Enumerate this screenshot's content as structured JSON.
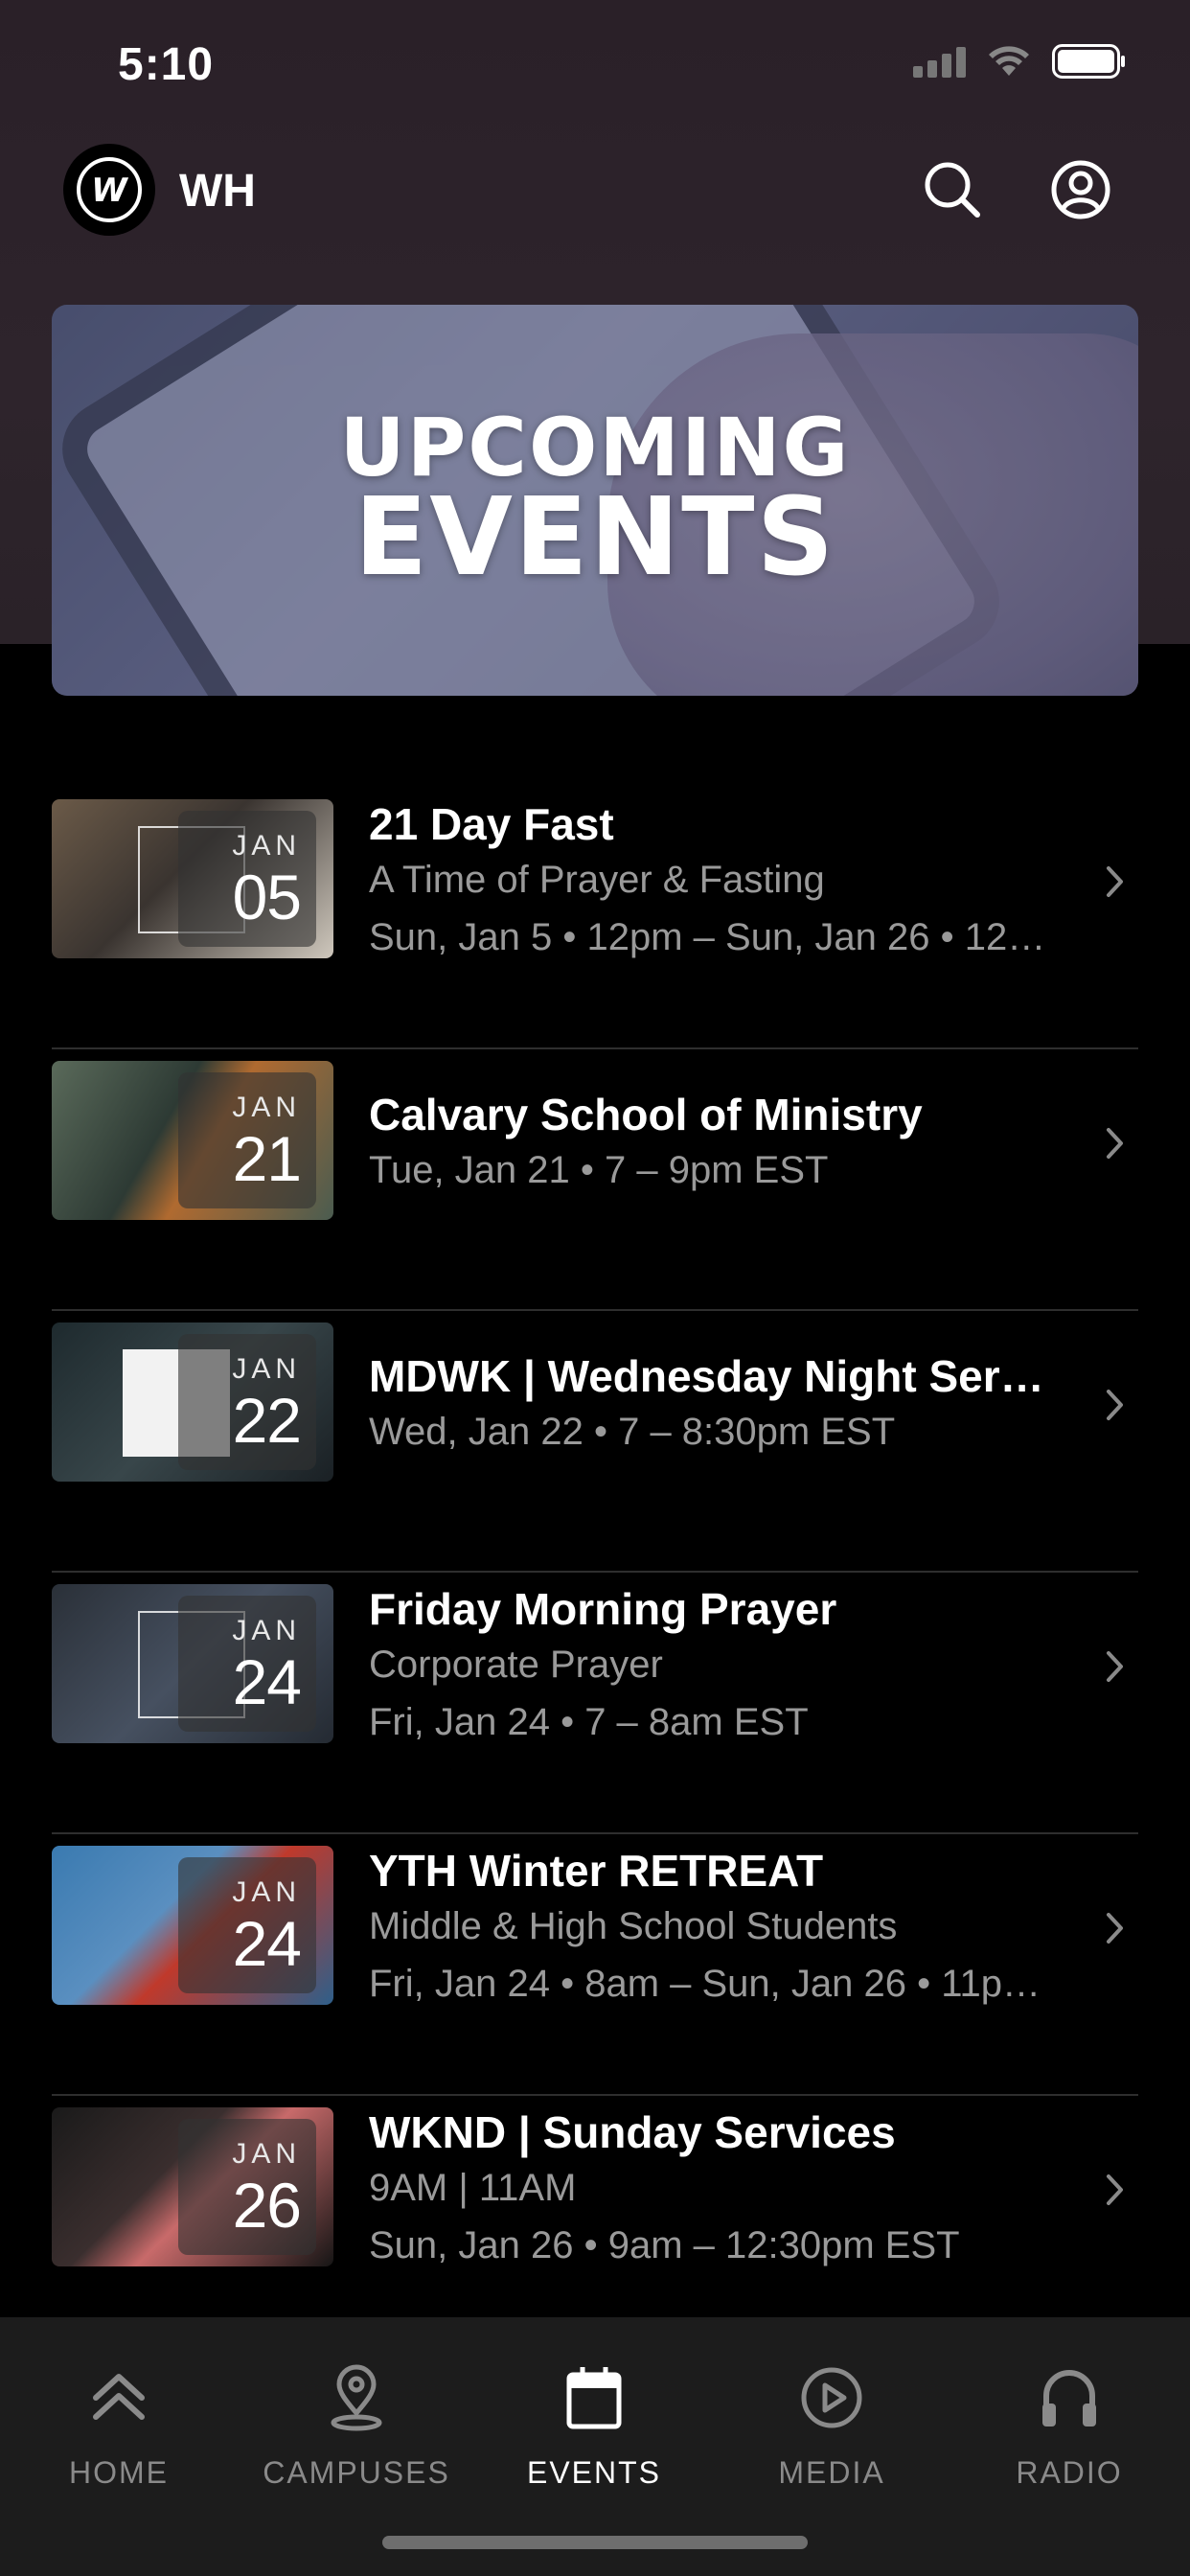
{
  "status_bar": {
    "time": "5:10"
  },
  "header": {
    "org_name": "WH",
    "logo_text": "W"
  },
  "banner": {
    "line1": "UPCOMING",
    "line2": "EVENTS"
  },
  "events": [
    {
      "title": "21 Day Fast",
      "subtitle": "A Time of Prayer & Fasting",
      "schedule": "Sun, Jan 5 • 12pm – Sun, Jan 26 • 12…",
      "month": "JAN",
      "day": "05"
    },
    {
      "title": "Calvary School of Ministry",
      "subtitle": "",
      "schedule": "Tue, Jan 21 • 7 – 9pm EST",
      "month": "JAN",
      "day": "21"
    },
    {
      "title": "MDWK | Wednesday Night Ser…",
      "subtitle": "",
      "schedule": "Wed, Jan 22 • 7 – 8:30pm EST",
      "month": "JAN",
      "day": "22"
    },
    {
      "title": "Friday Morning Prayer",
      "subtitle": "Corporate Prayer",
      "schedule": "Fri, Jan 24 • 7 – 8am EST",
      "month": "JAN",
      "day": "24"
    },
    {
      "title": "YTH Winter RETREAT",
      "subtitle": "Middle & High School Students",
      "schedule": "Fri, Jan 24 • 8am – Sun, Jan 26 • 11p…",
      "month": "JAN",
      "day": "24"
    },
    {
      "title": "WKND | Sunday Services",
      "subtitle": "9AM  |  11AM",
      "schedule": "Sun, Jan 26 • 9am – 12:30pm EST",
      "month": "JAN",
      "day": "26"
    }
  ],
  "tabs": [
    {
      "label": "HOME",
      "icon": "home-chevrons-icon",
      "active": false
    },
    {
      "label": "CAMPUSES",
      "icon": "location-pin-icon",
      "active": false
    },
    {
      "label": "EVENTS",
      "icon": "calendar-icon",
      "active": true
    },
    {
      "label": "MEDIA",
      "icon": "play-circle-icon",
      "active": false
    },
    {
      "label": "RADIO",
      "icon": "headphones-icon",
      "active": false
    }
  ],
  "colors": {
    "background": "#000000",
    "header_bg": "#2c2229",
    "tab_bar_bg": "#1c1c1c",
    "secondary_text": "#9a9a9a",
    "active_tab": "#ffffff",
    "inactive_tab": "#8a8a8a"
  }
}
